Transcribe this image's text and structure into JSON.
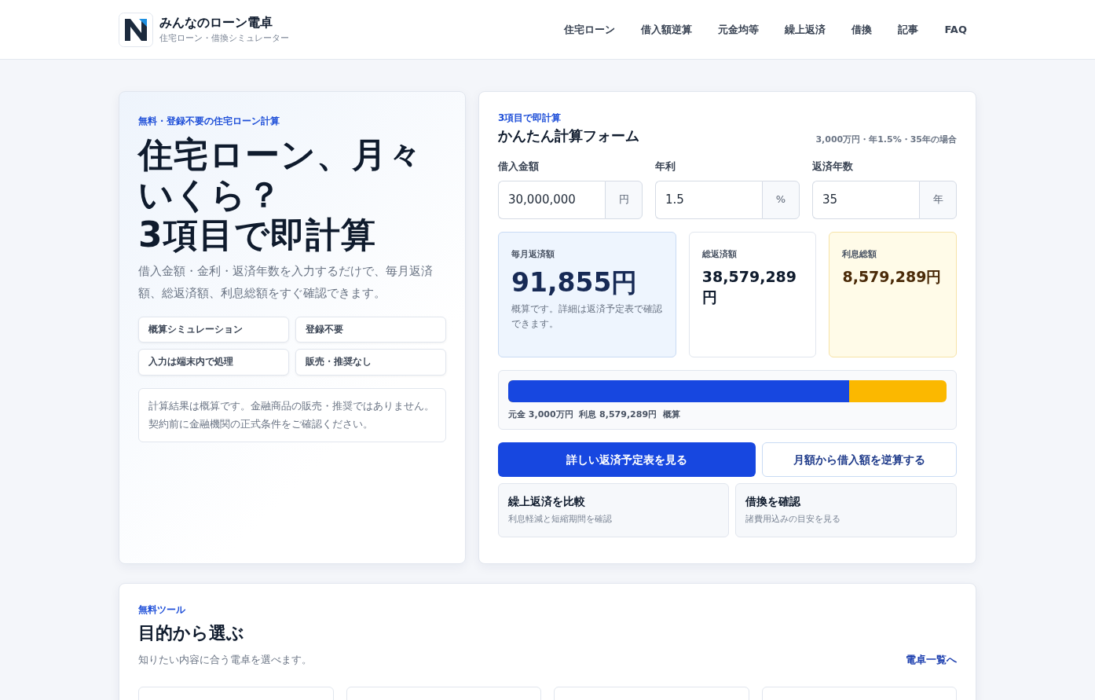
{
  "header": {
    "brand_title": "みんなのローン電卓",
    "brand_subtitle": "住宅ローン・借換シミュレーター",
    "nav": [
      {
        "label": "住宅ローン"
      },
      {
        "label": "借入額逆算"
      },
      {
        "label": "元金均等"
      },
      {
        "label": "繰上返済"
      },
      {
        "label": "借換"
      },
      {
        "label": "記事"
      },
      {
        "label": "FAQ"
      }
    ]
  },
  "hero": {
    "eyebrow": "無料・登録不要の住宅ローン計算",
    "headline_lines": [
      "住宅ローン、月々",
      "いくら？",
      "3項目で即計算"
    ],
    "lead": "借入金額・金利・返済年数を入力するだけで、毎月返済額、総返済額、利息総額をすぐ確認できます。",
    "features": [
      "概算シミュレーション",
      "登録不要",
      "入力は端末内で処理",
      "販売・推奨なし"
    ],
    "disclaimer": "計算結果は概算です。金融商品の販売・推奨ではありません。契約前に金融機関の正式条件をご確認ください。"
  },
  "calculator": {
    "eyebrow": "3項目で即計算",
    "title": "かんたん計算フォーム",
    "example": "3,000万円・年1.5%・35年の場合",
    "inputs": [
      {
        "label": "借入金額",
        "value": "30,000,000",
        "unit": "円"
      },
      {
        "label": "年利",
        "value": "1.5",
        "unit": "%"
      },
      {
        "label": "返済年数",
        "value": "35",
        "unit": "年"
      }
    ],
    "results": [
      {
        "kind": "primary",
        "label": "毎月返済額",
        "value": "91,855円",
        "note": "概算です。詳細は返済予定表で確認できます。"
      },
      {
        "kind": "plain",
        "label": "総返済額",
        "value": "38,579,289円"
      },
      {
        "kind": "interest",
        "label": "利息総額",
        "value": "8,579,289円"
      }
    ],
    "breakdown": {
      "level": 0.778,
      "caption": "元金 3,000万円  利息 8,579,289円  概算"
    },
    "primary_button": "詳しい返済予定表を見る",
    "secondary_button": "月額から借入額を逆算する",
    "links": [
      {
        "title": "繰上返済を比較",
        "subtitle": "利息軽減と短縮期間を確認"
      },
      {
        "title": "借換を確認",
        "subtitle": "諸費用込みの目安を見る"
      }
    ]
  },
  "tools": {
    "eyebrow": "無料ツール",
    "title": "目的から選ぶ",
    "description": "知りたい内容に合う電卓を選べます。",
    "more_link": "電卓一覧へ"
  }
}
